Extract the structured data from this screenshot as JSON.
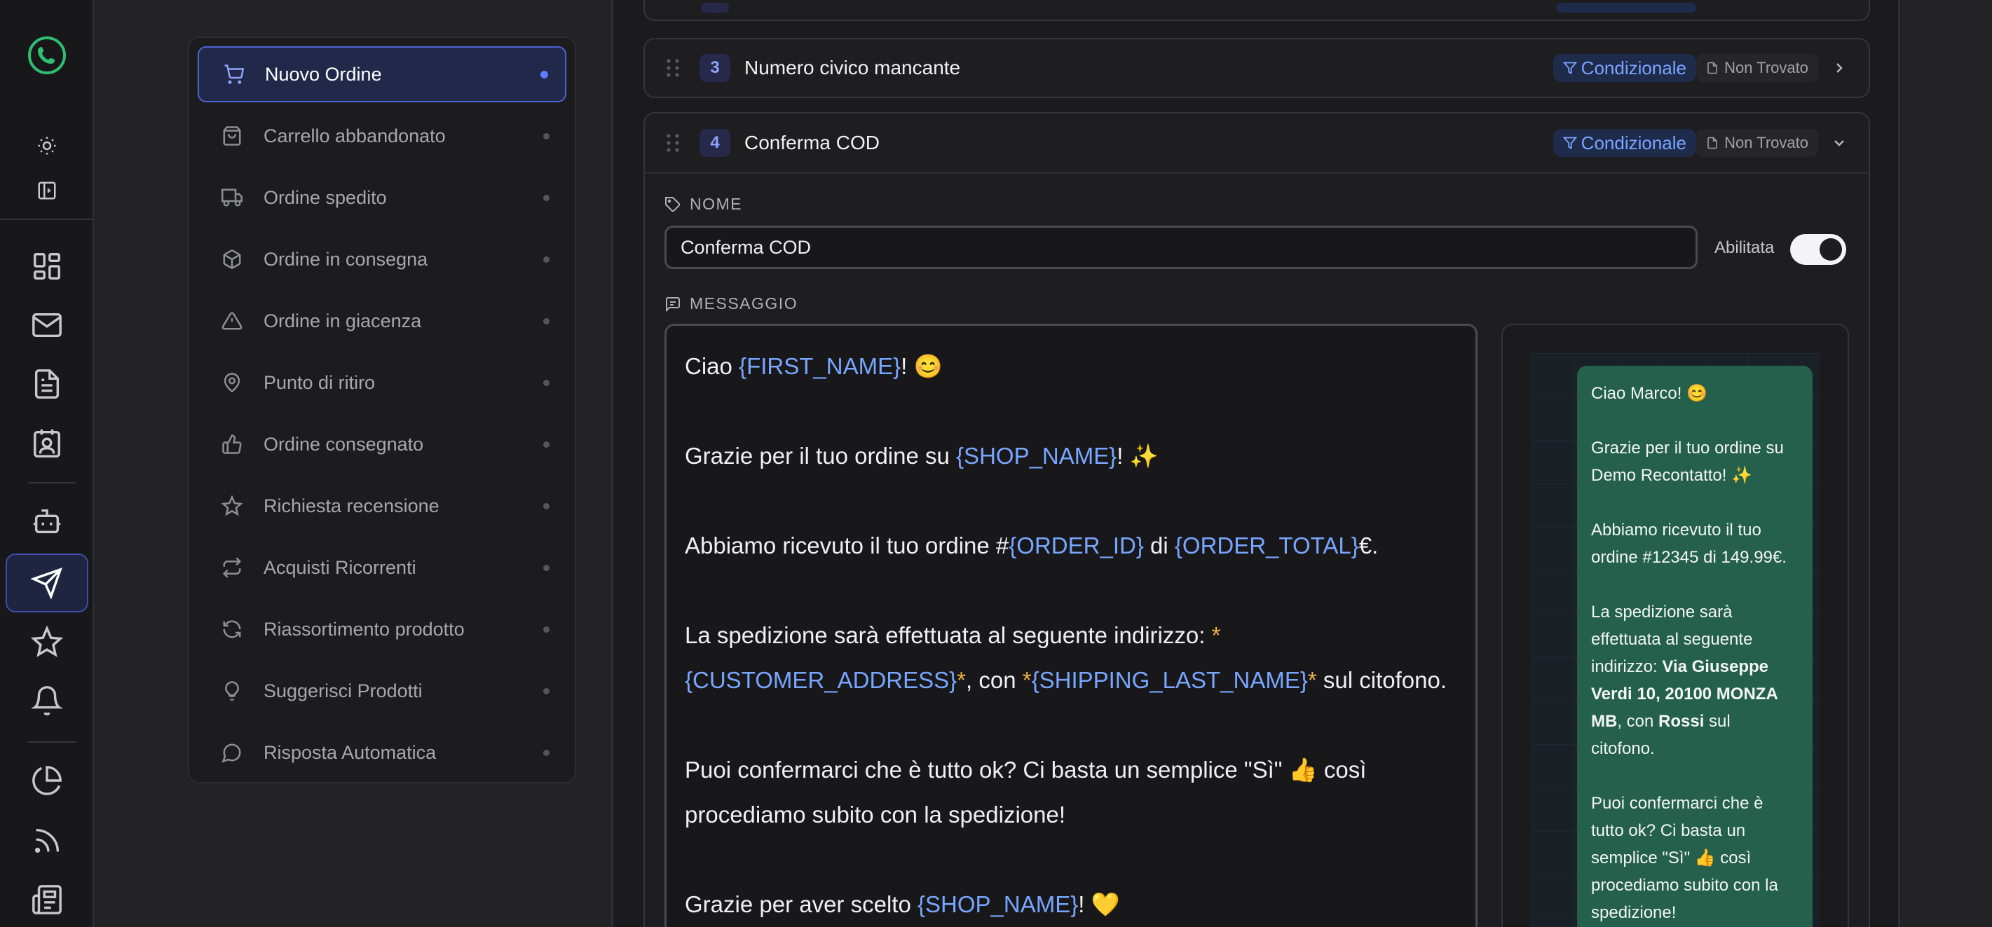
{
  "nav": {
    "items": [
      {
        "label": "Nuovo Ordine",
        "icon": "cart-icon"
      },
      {
        "label": "Carrello abbandonato",
        "icon": "bag-icon"
      },
      {
        "label": "Ordine spedito",
        "icon": "truck-icon"
      },
      {
        "label": "Ordine in consegna",
        "icon": "package-icon"
      },
      {
        "label": "Ordine in giacenza",
        "icon": "warning-icon"
      },
      {
        "label": "Punto di ritiro",
        "icon": "map-pin-icon"
      },
      {
        "label": "Ordine consegnato",
        "icon": "thumbs-up-icon"
      },
      {
        "label": "Richiesta recensione",
        "icon": "star-icon"
      },
      {
        "label": "Acquisti Ricorrenti",
        "icon": "repeat-icon"
      },
      {
        "label": "Riassortimento prodotto",
        "icon": "refresh-icon"
      },
      {
        "label": "Suggerisci Prodotti",
        "icon": "lightbulb-icon"
      },
      {
        "label": "Risposta Automatica",
        "icon": "chat-bubble-icon"
      }
    ]
  },
  "steps": [
    {
      "number": "3",
      "title": "Numero civico mancante",
      "condition": "Condizionale",
      "status": "Non Trovato"
    },
    {
      "number": "4",
      "title": "Conferma COD",
      "condition": "Condizionale",
      "status": "Non Trovato"
    }
  ],
  "form": {
    "name_label": "NOME",
    "name_value": "Conferma COD",
    "enabled_label": "Abilitata",
    "message_label": "MESSAGGIO"
  },
  "editor": {
    "line1_a": "Ciao ",
    "line1_var": "{FIRST_NAME}",
    "line1_b": "! 😊",
    "line2_a": "Grazie per il tuo ordine su ",
    "line2_var": "{SHOP_NAME}",
    "line2_b": "! ✨",
    "line3_a": "Abbiamo ricevuto il tuo ordine #",
    "line3_var1": "{ORDER_ID}",
    "line3_b": " di ",
    "line3_var2": "{ORDER_TOTAL}",
    "line3_c": "€.",
    "line4_a": "La spedizione sarà effettuata al seguente indirizzo: ",
    "line4_star": "*",
    "line5_var1": "{CUSTOMER_ADDRESS}",
    "line5_star1": "*",
    "line5_b": ", con ",
    "line5_star2": "*",
    "line5_var2": "{SHIPPING_LAST_NAME}",
    "line5_star3": "*",
    "line5_c": " sul citofono.",
    "line6": "Puoi confermarci che è tutto ok? Ci basta un semplice \"Sì\" 👍 così",
    "line7": "procediamo subito con la spedizione!",
    "line8_a": "Grazie per aver scelto ",
    "line8_var": "{SHOP_NAME}",
    "line8_b": "! 💛"
  },
  "preview": {
    "p1": "Ciao Marco! 😊",
    "p2a": "Grazie per il tuo ordine su",
    "p2b": "Demo Recontatto! ✨",
    "p3a": "Abbiamo ricevuto il tuo",
    "p3b": "ordine #12345 di 149.99€.",
    "p4a": "La spedizione sarà",
    "p4b": "effettuata al seguente",
    "p4c_pre": "indirizzo: ",
    "p4c_bold": "Via Giuseppe",
    "p4d_bold": "Verdi 10, 20100 MONZA",
    "p4e_bold": "MB",
    "p4e_post": ", con ",
    "p4e_bold2": "Rossi",
    "p4e_end": " sul",
    "p4f": "citofono.",
    "p5a": "Puoi confermarci che è",
    "p5b": "tutto ok? Ci basta un",
    "p5c": "semplice \"Sì\" 👍 così",
    "p5d": "procediamo subito con la",
    "p5e": "spedizione!"
  }
}
